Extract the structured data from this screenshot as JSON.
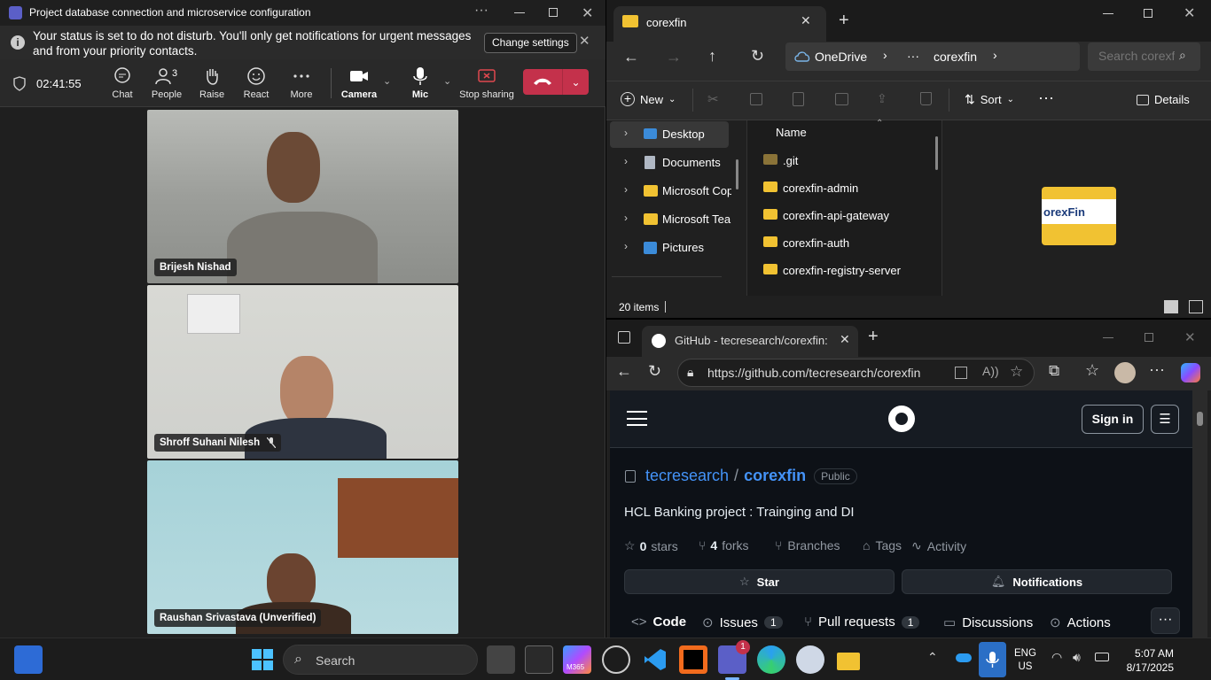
{
  "teams": {
    "title": "Project database connection and microservice configuration",
    "notice": "Your status is set to do not disturb. You'll only get notifications for urgent messages and from your priority contacts.",
    "change_settings": "Change settings",
    "timer": "02:41:55",
    "people_count": "3",
    "buttons": {
      "chat": "Chat",
      "people": "People",
      "raise": "Raise",
      "react": "React",
      "more": "More",
      "camera": "Camera",
      "mic": "Mic",
      "stop_sharing": "Stop sharing"
    },
    "participants": [
      "Brijesh Nishad",
      "Shroff Suhani Nilesh",
      "Raushan Srivastava (Unverified)"
    ]
  },
  "explorer": {
    "tab_title": "corexfin",
    "breadcrumb": {
      "root": "OneDrive",
      "ellipsis": "···",
      "current": "corexfin"
    },
    "search_placeholder": "Search corexfin",
    "toolbar": {
      "new": "New",
      "sort": "Sort",
      "details": "Details"
    },
    "nav": [
      "Desktop",
      "Documents",
      "Microsoft Cop",
      "Microsoft Tear",
      "Pictures"
    ],
    "column_name": "Name",
    "files": [
      ".git",
      "corexfin-admin",
      "corexfin-api-gateway",
      "corexfin-auth",
      "corexfin-registry-server"
    ],
    "status": "20 items",
    "preview_label": "orexFin"
  },
  "edge": {
    "tab_title": "GitHub - tecresearch/corexfin: HC",
    "url": "https://github.com/tecresearch/corexfin",
    "github": {
      "sign_in": "Sign in",
      "owner": "tecresearch",
      "slash": "/",
      "repo": "corexfin",
      "visibility": "Public",
      "description": "HCL Banking project : Trainging and DI",
      "stars_count": "0",
      "stars_label": "stars",
      "forks_count": "4",
      "forks_label": "forks",
      "branches": "Branches",
      "tags": "Tags",
      "activity": "Activity",
      "star_button": "Star",
      "notifications_button": "Notifications",
      "tabs": [
        {
          "label": "Code",
          "count": ""
        },
        {
          "label": "Issues",
          "count": "1"
        },
        {
          "label": "Pull requests",
          "count": "1"
        },
        {
          "label": "Discussions",
          "count": ""
        },
        {
          "label": "Actions",
          "count": ""
        }
      ]
    }
  },
  "taskbar": {
    "search": "Search",
    "m365": "M365",
    "teams_badge": "1",
    "lang": "ENG",
    "region": "US",
    "time": "5:07 AM",
    "date": "8/17/2025"
  }
}
